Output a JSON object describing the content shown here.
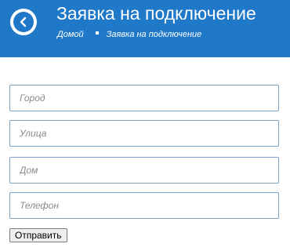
{
  "header": {
    "title": "Заявка на подключение",
    "breadcrumb": {
      "home": "Домой",
      "current": "Заявка на подключение"
    },
    "back_icon": "chevron-left-icon",
    "accent_color": "#1f78c8"
  },
  "form": {
    "city_placeholder": "Город",
    "street_placeholder": "Улица",
    "house_placeholder": "Дом",
    "phone_placeholder": "Телефон",
    "submit_label": "Отправить"
  }
}
